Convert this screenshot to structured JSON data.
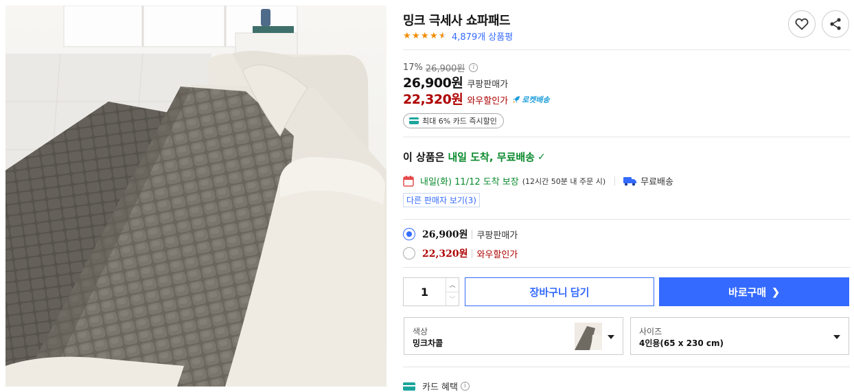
{
  "product": {
    "title": "밍크 극세사 쇼파패드",
    "rating_stars": 4.5,
    "review_count": "4,879개 상품평"
  },
  "price": {
    "discount_rate": "17%",
    "original_price": "26,900원",
    "coupang_price": "26,900원",
    "coupang_label": "쿠팡판매가",
    "wow_price": "22,320원",
    "wow_label": "와우할인가",
    "rocket_badge": "로켓배송",
    "card_discount_chip": "최대 6% 카드 즉시할인"
  },
  "delivery": {
    "headline_prefix": "이 상품은",
    "headline_highlight": "내일 도착, 무료배송",
    "arrival": "내일(화) 11/12 도착 보장",
    "arrival_note": "(12시간 50분 내 주문 시)",
    "shipping": "무료배송",
    "other_sellers": "다른 판매자 보기",
    "other_sellers_count": "(3)"
  },
  "price_options": [
    {
      "price": "26,900원",
      "label": "쿠팡판매가",
      "selected": true
    },
    {
      "price": "22,320원",
      "label": "와우할인가",
      "selected": false
    }
  ],
  "purchase": {
    "quantity": "1",
    "cart_label": "장바구니 담기",
    "buy_label": "바로구매"
  },
  "options": {
    "color_label": "색상",
    "color_value": "밍크차콜",
    "size_label": "사이즈",
    "size_value": "4인용(65 x 230 cm)"
  },
  "card_benefit_label": "카드 혜택",
  "colors": {
    "accent_blue": "#346aff",
    "wow_red": "#ae0000",
    "delivery_green": "#0a8a2d",
    "star_orange": "#f28b00",
    "rocket_blue": "#1f9ed9"
  },
  "icons": [
    "heart-icon",
    "share-icon",
    "info-icon",
    "calendar-icon",
    "truck-icon",
    "check-icon",
    "card-icon",
    "rocket-icon",
    "chevron-right-icon",
    "caret-down-icon"
  ]
}
